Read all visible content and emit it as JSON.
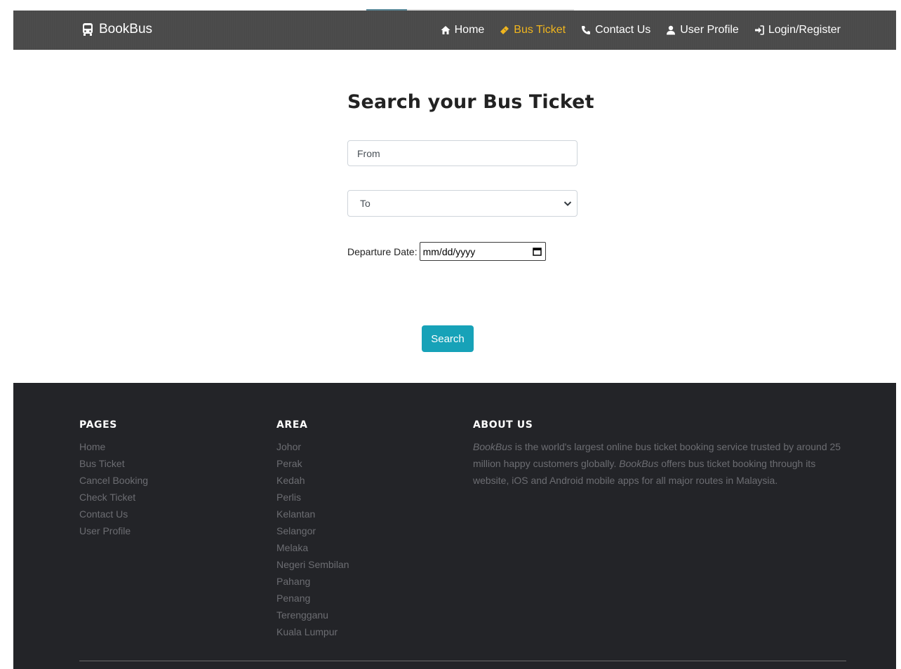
{
  "brand": {
    "name": "BookBus"
  },
  "nav": {
    "items": [
      {
        "label": "Home",
        "icon": "home-icon",
        "active": false
      },
      {
        "label": "Bus Ticket",
        "icon": "ticket-icon",
        "active": true
      },
      {
        "label": "Contact Us",
        "icon": "phone-icon",
        "active": false
      },
      {
        "label": "User Profile",
        "icon": "user-icon",
        "active": false
      },
      {
        "label": "Login/Register",
        "icon": "sign-in-icon",
        "active": false
      }
    ],
    "active_color": "#f0b51e"
  },
  "search": {
    "title": "Search your Bus Ticket",
    "from_placeholder": "From",
    "to_selected": "To",
    "date_label": "Departure Date:",
    "date_placeholder": "mm/dd/yyyy",
    "button_label": "Search",
    "button_color": "#17a2b8"
  },
  "footer": {
    "pages": {
      "title": "PAGES",
      "items": [
        "Home",
        "Bus Ticket",
        "Cancel Booking",
        "Check Ticket",
        "Contact Us",
        "User Profile"
      ]
    },
    "area": {
      "title": "AREA",
      "items": [
        "Johor",
        "Perak",
        "Kedah",
        "Perlis",
        "Kelantan",
        "Selangor",
        "Melaka",
        "Negeri Sembilan",
        "Pahang",
        "Penang",
        "Terengganu",
        "Kuala Lumpur"
      ]
    },
    "about": {
      "title": "ABOUT US",
      "brand_em": "BookBus",
      "text_1": " is the world's largest online bus ticket booking service trusted by around 25 million happy customers globally. ",
      "text_2": " offers bus ticket booking through its website, iOS and Android mobile apps for all major routes in Malaysia."
    },
    "background_color": "#232428"
  }
}
